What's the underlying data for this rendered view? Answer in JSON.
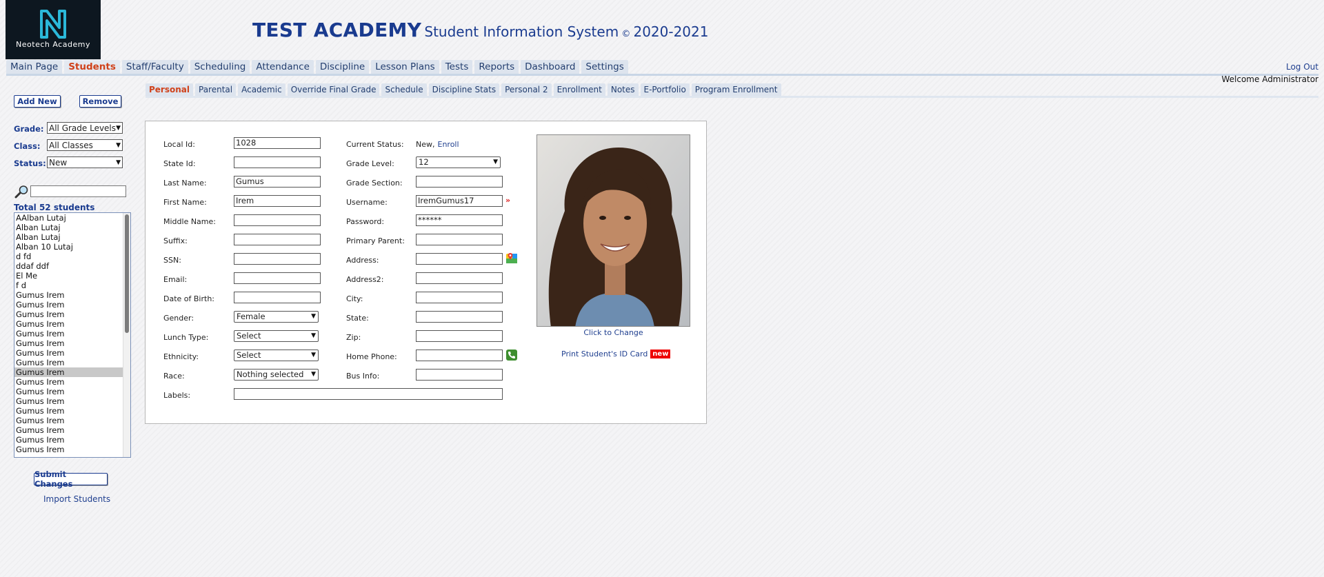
{
  "header": {
    "logo_text": "Neotech Academy",
    "brand": "TEST ACADEMY",
    "subtitle": "Student Information System",
    "copyright": "©",
    "years": "2020-2021"
  },
  "main_nav": [
    {
      "label": "Main Page"
    },
    {
      "label": "Students",
      "active": true
    },
    {
      "label": "Staff/Faculty"
    },
    {
      "label": "Scheduling"
    },
    {
      "label": "Attendance"
    },
    {
      "label": "Discipline"
    },
    {
      "label": "Lesson Plans"
    },
    {
      "label": "Tests"
    },
    {
      "label": "Reports"
    },
    {
      "label": "Dashboard"
    },
    {
      "label": "Settings"
    }
  ],
  "logout_label": "Log Out",
  "welcome": "Welcome Administrator",
  "sidebar": {
    "add_new": "Add New",
    "remove": "Remove",
    "grade_label": "Grade:",
    "grade_value": "All Grade Levels",
    "class_label": "Class:",
    "class_value": "All Classes",
    "status_label": "Status:",
    "status_value": "New",
    "search_value": "",
    "total": "Total 52 students",
    "students": [
      "AAlban Lutaj",
      "Alban Lutaj",
      "Alban Lutaj",
      "Alban 10 Lutaj",
      "d fd",
      "ddaf ddf",
      "El Me",
      "f d",
      "Gumus Irem",
      "Gumus Irem",
      "Gumus Irem",
      "Gumus Irem",
      "Gumus Irem",
      "Gumus Irem",
      "Gumus Irem",
      "Gumus Irem",
      "Gumus Irem",
      "Gumus Irem",
      "Gumus Irem",
      "Gumus Irem",
      "Gumus Irem",
      "Gumus Irem",
      "Gumus Irem",
      "Gumus Irem",
      "Gumus Irem"
    ],
    "selected_index": 16,
    "submit": "Submit Changes",
    "import": "Import Students"
  },
  "sub_tabs": [
    {
      "label": "Personal",
      "active": true
    },
    {
      "label": "Parental"
    },
    {
      "label": "Academic"
    },
    {
      "label": "Override Final Grade"
    },
    {
      "label": "Schedule"
    },
    {
      "label": "Discipline Stats"
    },
    {
      "label": "Personal 2"
    },
    {
      "label": "Enrollment"
    },
    {
      "label": "Notes"
    },
    {
      "label": "E-Portfolio"
    },
    {
      "label": "Program Enrollment"
    }
  ],
  "form": {
    "local_id": {
      "label": "Local Id:",
      "value": "1028"
    },
    "state_id": {
      "label": "State Id:",
      "value": ""
    },
    "last_name": {
      "label": "Last Name:",
      "value": "Gumus"
    },
    "first_name": {
      "label": "First Name:",
      "value": "Irem"
    },
    "middle_name": {
      "label": "Middle Name:",
      "value": ""
    },
    "suffix": {
      "label": "Suffix:",
      "value": ""
    },
    "ssn": {
      "label": "SSN:",
      "value": ""
    },
    "email": {
      "label": "Email:",
      "value": ""
    },
    "dob": {
      "label": "Date of Birth:",
      "value": ""
    },
    "gender": {
      "label": "Gender:",
      "value": "Female"
    },
    "lunch_type": {
      "label": "Lunch Type:",
      "value": "Select"
    },
    "ethnicity": {
      "label": "Ethnicity:",
      "value": "Select"
    },
    "race": {
      "label": "Race:",
      "value": "Nothing selected"
    },
    "labels": {
      "label": "Labels:",
      "value": ""
    },
    "current_status": {
      "label": "Current Status:",
      "value": "New,",
      "link": "Enroll"
    },
    "grade_level": {
      "label": "Grade Level:",
      "value": "12"
    },
    "grade_section": {
      "label": "Grade Section:",
      "value": ""
    },
    "username": {
      "label": "Username:",
      "value": "IremGumus17",
      "marker": "»"
    },
    "password": {
      "label": "Password:",
      "value": "******"
    },
    "primary_parent": {
      "label": "Primary Parent:",
      "value": ""
    },
    "address": {
      "label": "Address:",
      "value": ""
    },
    "address2": {
      "label": "Address2:",
      "value": ""
    },
    "city": {
      "label": "City:",
      "value": ""
    },
    "state": {
      "label": "State:",
      "value": ""
    },
    "zip": {
      "label": "Zip:",
      "value": ""
    },
    "home_phone": {
      "label": "Home Phone:",
      "value": ""
    },
    "bus_info": {
      "label": "Bus Info:",
      "value": ""
    }
  },
  "photo": {
    "click_to_change": "Click to Change",
    "print_id": "Print Student's ID Card",
    "new_badge": "new"
  },
  "colors": {
    "brand_blue": "#1a3b8f",
    "active_tab": "#d0421b",
    "logo_bg": "#0d1720",
    "logo_mark": "#2bb8d9",
    "badge_red": "#ee0000"
  }
}
